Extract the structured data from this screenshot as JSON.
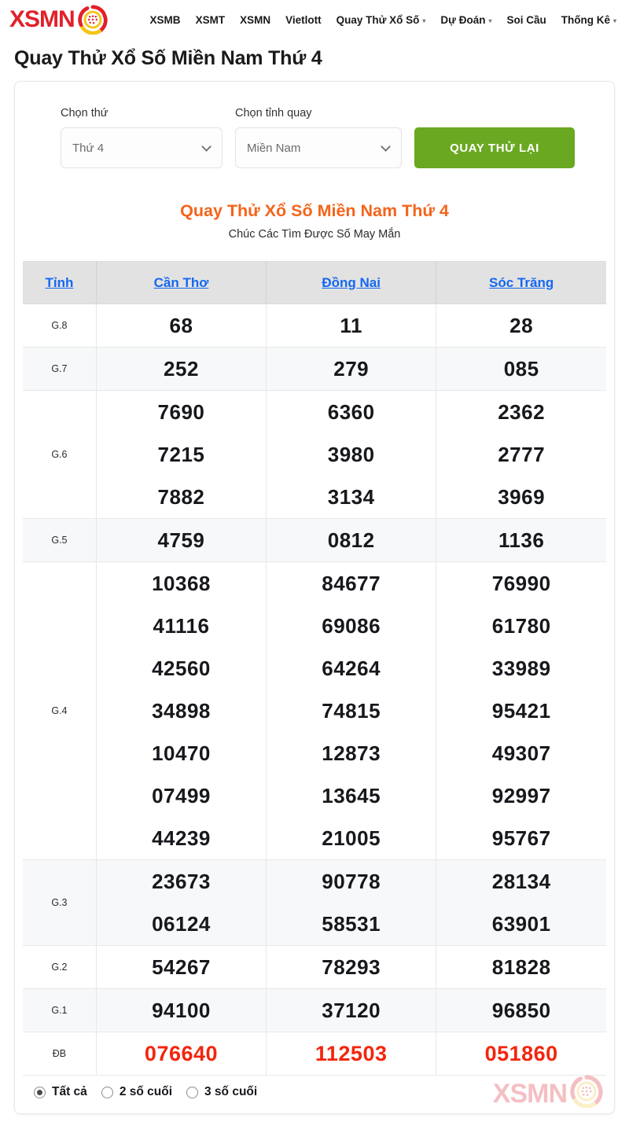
{
  "header": {
    "brand_text": "XSMN",
    "brand_icon": "lottery-ball-icon",
    "nav": [
      {
        "label": "XSMB",
        "has_caret": false
      },
      {
        "label": "XSMT",
        "has_caret": false
      },
      {
        "label": "XSMN",
        "has_caret": false
      },
      {
        "label": "Vietlott",
        "has_caret": false
      },
      {
        "label": "Quay Thử Xổ Số",
        "has_caret": true
      },
      {
        "label": "Dự Đoán",
        "has_caret": true
      },
      {
        "label": "Soi Cầu",
        "has_caret": false
      },
      {
        "label": "Thống Kê",
        "has_caret": true
      }
    ]
  },
  "page_title": "Quay Thử Xổ Số Miền Nam Thứ 4",
  "form": {
    "day_label": "Chọn thứ",
    "day_value": "Thứ 4",
    "province_label": "Chọn tỉnh quay",
    "province_value": "Miền Nam",
    "spin_button": "QUAY THỬ LẠI"
  },
  "result": {
    "heading": "Quay Thử Xổ Số Miền Nam Thứ 4",
    "subtitle": "Chúc Các Tìm Được Số May Mắn"
  },
  "table": {
    "headers": [
      "Tỉnh",
      "Cần Thơ",
      "Đồng Nai",
      "Sóc Trăng"
    ],
    "rows": [
      {
        "prize": "G.8",
        "values": [
          [
            "68"
          ],
          [
            "11"
          ],
          [
            "28"
          ]
        ]
      },
      {
        "prize": "G.7",
        "values": [
          [
            "252"
          ],
          [
            "279"
          ],
          [
            "085"
          ]
        ]
      },
      {
        "prize": "G.6",
        "values": [
          [
            "7690",
            "7215",
            "7882"
          ],
          [
            "6360",
            "3980",
            "3134"
          ],
          [
            "2362",
            "2777",
            "3969"
          ]
        ]
      },
      {
        "prize": "G.5",
        "values": [
          [
            "4759"
          ],
          [
            "0812"
          ],
          [
            "1136"
          ]
        ]
      },
      {
        "prize": "G.4",
        "values": [
          [
            "10368",
            "41116",
            "42560",
            "34898",
            "10470",
            "07499",
            "44239"
          ],
          [
            "84677",
            "69086",
            "64264",
            "74815",
            "12873",
            "13645",
            "21005"
          ],
          [
            "76990",
            "61780",
            "33989",
            "95421",
            "49307",
            "92997",
            "95767"
          ]
        ]
      },
      {
        "prize": "G.3",
        "values": [
          [
            "23673",
            "06124"
          ],
          [
            "90778",
            "58531"
          ],
          [
            "28134",
            "63901"
          ]
        ]
      },
      {
        "prize": "G.2",
        "values": [
          [
            "54267"
          ],
          [
            "78293"
          ],
          [
            "81828"
          ]
        ]
      },
      {
        "prize": "G.1",
        "values": [
          [
            "94100"
          ],
          [
            "37120"
          ],
          [
            "96850"
          ]
        ]
      },
      {
        "prize": "ĐB",
        "special": true,
        "values": [
          [
            "076640"
          ],
          [
            "112503"
          ],
          [
            "051860"
          ]
        ]
      }
    ]
  },
  "filters": {
    "options": [
      {
        "label": "Tất cả",
        "checked": true
      },
      {
        "label": "2 số cuối",
        "checked": false
      },
      {
        "label": "3 số cuối",
        "checked": false
      }
    ]
  },
  "watermark": {
    "text": "XSMN",
    "icon": "lottery-ball-icon"
  },
  "colors": {
    "brand_red": "#e1212b",
    "accent_orange": "#f4641b",
    "button_green": "#6aa821",
    "link_blue": "#1568f0",
    "special_red": "#f3250d",
    "header_gray": "#e2e2e2"
  }
}
